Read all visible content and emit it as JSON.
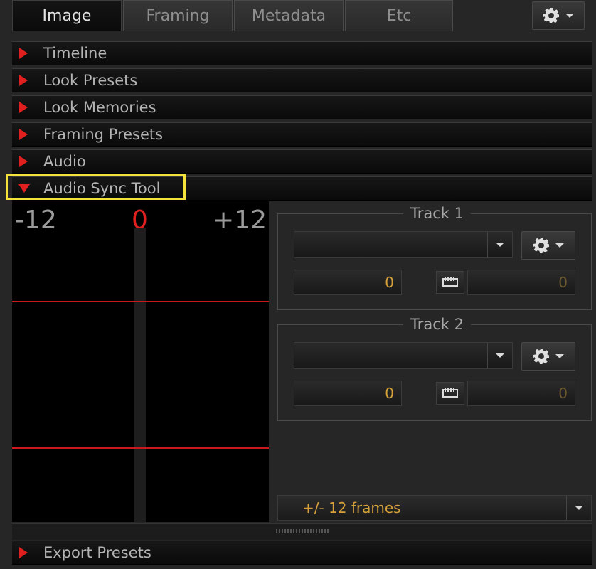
{
  "tabs": [
    {
      "label": "Image",
      "active": true
    },
    {
      "label": "Framing",
      "active": false
    },
    {
      "label": "Metadata",
      "active": false
    },
    {
      "label": "Etc",
      "active": false
    }
  ],
  "sections": {
    "timeline": "Timeline",
    "look_presets": "Look Presets",
    "look_memories": "Look Memories",
    "framing_presets": "Framing Presets",
    "audio": "Audio",
    "audio_sync_tool": "Audio Sync Tool",
    "export_presets": "Export Presets"
  },
  "meter": {
    "left_label": "-12",
    "center_label": "0",
    "right_label": "+12"
  },
  "track1": {
    "title": "Track 1",
    "source_value": "",
    "offset_value": "0",
    "frames_value": "0"
  },
  "track2": {
    "title": "Track 2",
    "source_value": "",
    "offset_value": "0",
    "frames_value": "0"
  },
  "range_select": {
    "value": "+/- 12 frames"
  },
  "colors": {
    "accent_red": "#e01f1f",
    "value_orange": "#d6a03a",
    "highlight_yellow": "#f2e23a"
  },
  "icons": {
    "settings": "gear-icon",
    "dropdown": "chevron-down-icon",
    "expand": "triangle-right-icon",
    "collapse": "triangle-down-icon",
    "timecode": "clapper-icon"
  }
}
